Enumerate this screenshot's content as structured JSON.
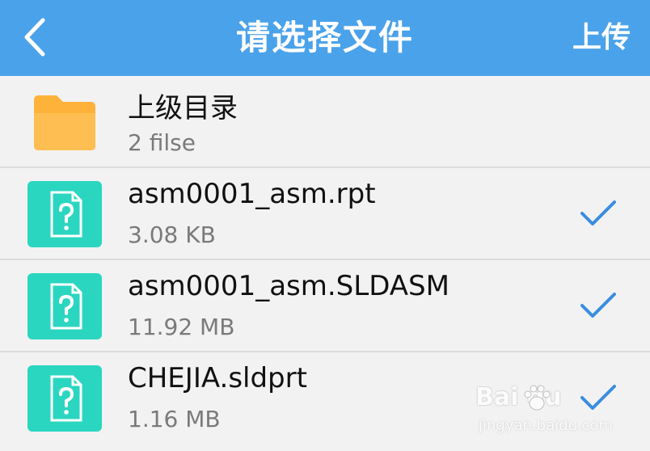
{
  "header": {
    "title": "请选择文件",
    "back_icon": "chevron-left-icon",
    "upload_label": "上传"
  },
  "colors": {
    "header_bg": "#4aa2ea",
    "folder": "#ffb23a",
    "file_icon": "#2bd6c0",
    "check": "#3a8de0"
  },
  "list": [
    {
      "kind": "folder",
      "icon": "folder-icon",
      "name": "上级目录",
      "meta": "2 filse",
      "checked": false
    },
    {
      "kind": "file",
      "icon": "unknown-file-icon",
      "name": "asm0001_asm.rpt",
      "meta": "3.08 KB",
      "checked": true
    },
    {
      "kind": "file",
      "icon": "unknown-file-icon",
      "name": "asm0001_asm.SLDASM",
      "meta": "11.92 MB",
      "checked": true
    },
    {
      "kind": "file",
      "icon": "unknown-file-icon",
      "name": "CHEJIA.sldprt",
      "meta": "1.16 MB",
      "checked": true
    }
  ],
  "watermark": {
    "brand": "Bai du",
    "url": "jingyan.baidu.com"
  }
}
